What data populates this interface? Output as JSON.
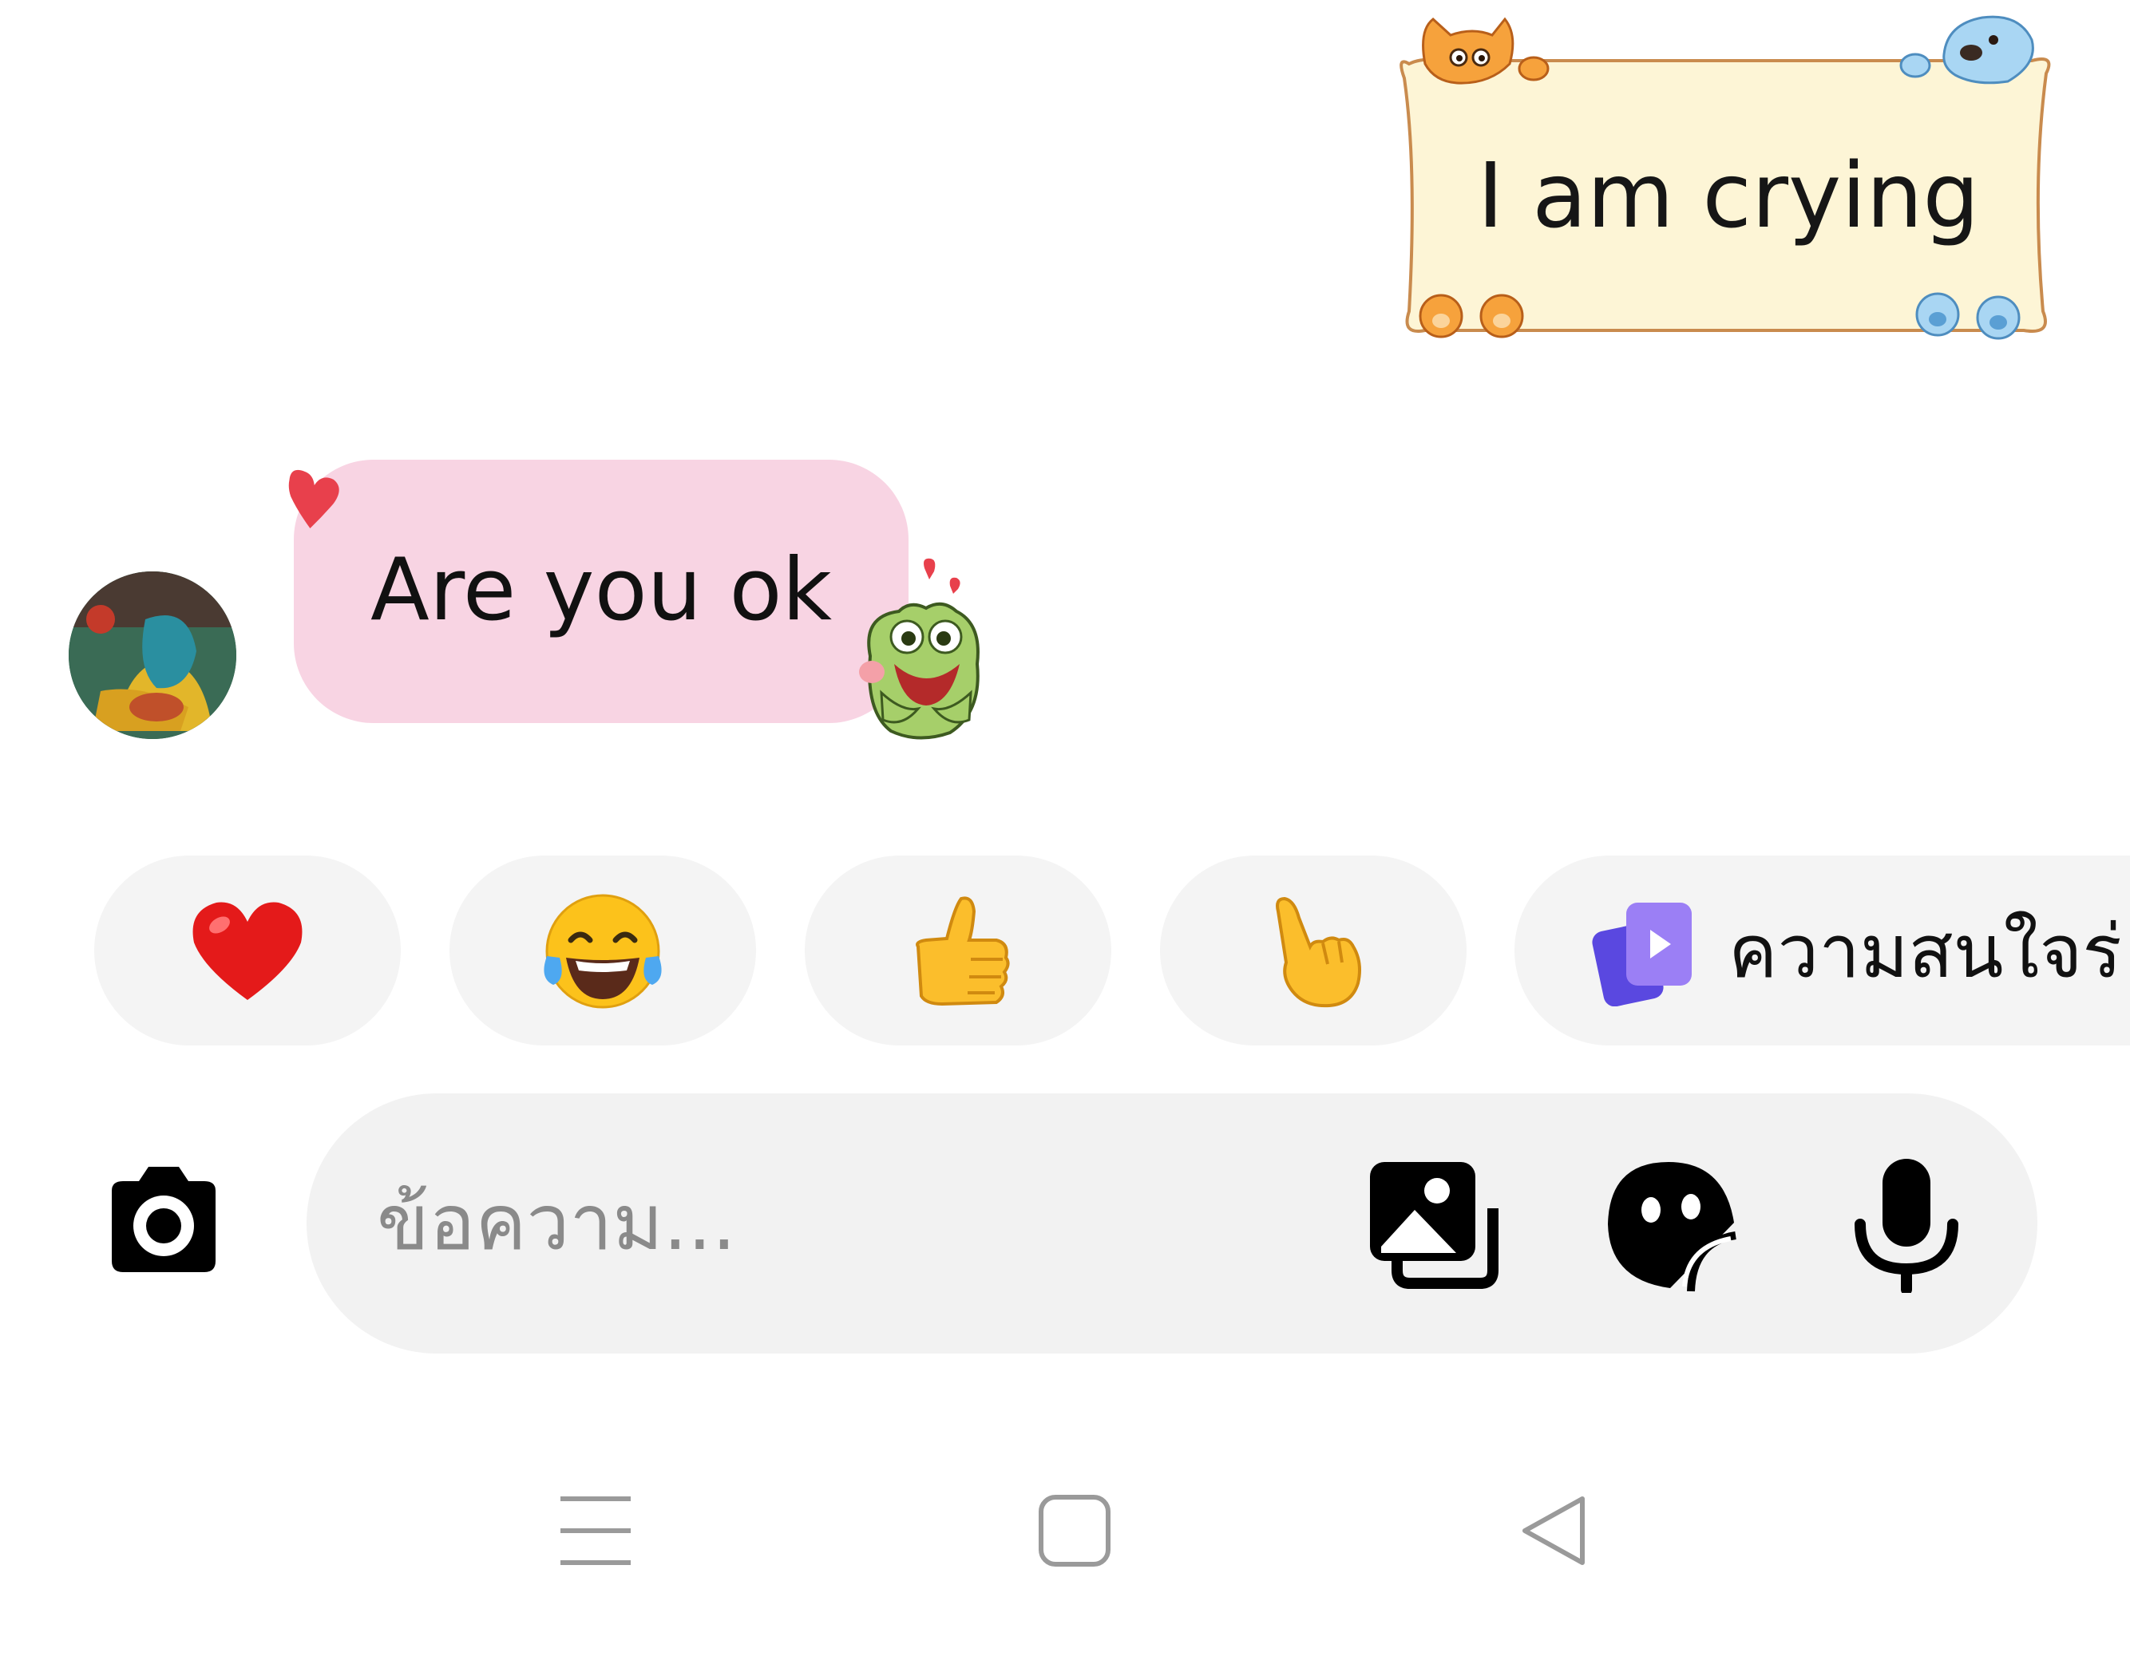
{
  "messages": {
    "sent": {
      "text": "I am crying"
    },
    "received": {
      "text": "Are you ok"
    }
  },
  "reactions": {
    "chips": [
      {
        "emoji": "❤️",
        "icon": "red-heart-emoji"
      },
      {
        "emoji": "😂",
        "icon": "tears-of-joy-emoji"
      },
      {
        "emoji": "👍",
        "icon": "thumbs-up-emoji"
      },
      {
        "emoji": "👆",
        "icon": "pointing-hand-emoji"
      }
    ],
    "interest_label": "ความสนใจร่"
  },
  "composer": {
    "placeholder": "ข้อความ...",
    "value": ""
  },
  "colors": {
    "received_bubble": "#f8d4e3",
    "chip_bg": "#f4f4f4",
    "composer_bg": "#f2f2f2",
    "interest_icon": "#7b5cf0"
  }
}
